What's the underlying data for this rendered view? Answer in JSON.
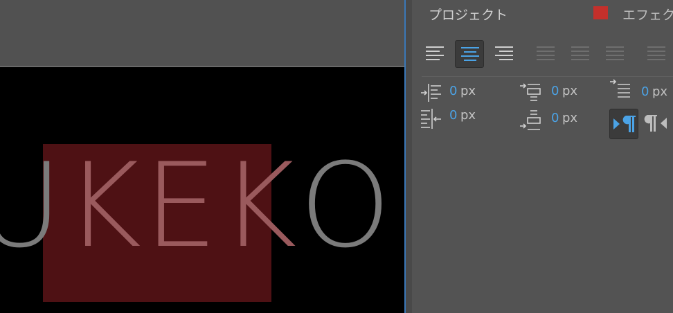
{
  "monitor": {
    "title_text": [
      "U",
      "K",
      "E",
      "K",
      "O"
    ]
  },
  "panel": {
    "tabs": {
      "project": "プロジェクト",
      "effects": "エフェク"
    },
    "align_buttons": [
      {
        "name": "align-left",
        "state": "normal"
      },
      {
        "name": "align-center",
        "state": "active"
      },
      {
        "name": "align-right",
        "state": "normal"
      },
      {
        "name": "justify-last-left",
        "state": "disabled"
      },
      {
        "name": "justify-last-center",
        "state": "disabled"
      },
      {
        "name": "justify-last-right",
        "state": "disabled"
      },
      {
        "name": "justify-all",
        "state": "disabled"
      }
    ],
    "fields": {
      "left_indent": {
        "value": "0",
        "unit": "px"
      },
      "space_before": {
        "value": "0",
        "unit": "px"
      },
      "first_line_indent": {
        "value": "0",
        "unit": "px"
      },
      "right_indent": {
        "value": "0",
        "unit": "px"
      },
      "space_after": {
        "value": "0",
        "unit": "px"
      }
    },
    "direction": {
      "ltr": {
        "icon": "ltr-paragraph-icon",
        "state": "active"
      },
      "rtl": {
        "icon": "rtl-paragraph-icon",
        "state": "normal"
      }
    },
    "colors": {
      "accent": "#4ba3e6",
      "close": "#c4302b",
      "highlight": "#4e1114"
    }
  }
}
